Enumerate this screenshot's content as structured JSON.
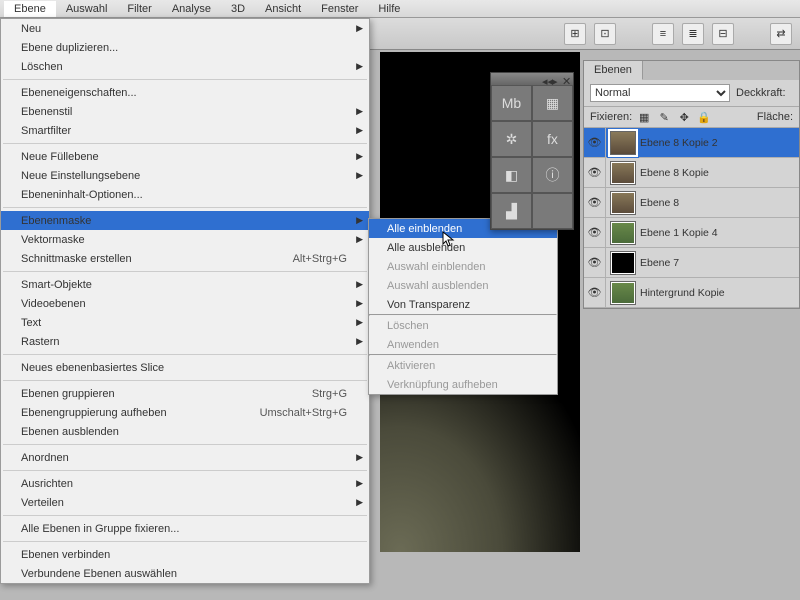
{
  "menubar": [
    "Ebene",
    "Auswahl",
    "Filter",
    "Analyse",
    "3D",
    "Ansicht",
    "Fenster",
    "Hilfe"
  ],
  "menu": {
    "items": [
      {
        "label": "Neu",
        "arrow": true
      },
      {
        "label": "Ebene duplizieren..."
      },
      {
        "label": "Löschen",
        "arrow": true
      },
      {
        "sep": true
      },
      {
        "label": "Ebeneneigenschaften..."
      },
      {
        "label": "Ebenenstil",
        "arrow": true
      },
      {
        "label": "Smartfilter",
        "arrow": true,
        "disabled": true
      },
      {
        "sep": true
      },
      {
        "label": "Neue Füllebene",
        "arrow": true
      },
      {
        "label": "Neue Einstellungsebene",
        "arrow": true
      },
      {
        "label": "Ebeneninhalt-Optionen...",
        "disabled": true
      },
      {
        "sep": true
      },
      {
        "label": "Ebenenmaske",
        "arrow": true,
        "hl": true
      },
      {
        "label": "Vektormaske",
        "arrow": true
      },
      {
        "label": "Schnittmaske erstellen",
        "shortcut": "Alt+Strg+G"
      },
      {
        "sep": true
      },
      {
        "label": "Smart-Objekte",
        "arrow": true
      },
      {
        "label": "Videoebenen",
        "arrow": true
      },
      {
        "label": "Text",
        "arrow": true,
        "disabled": true
      },
      {
        "label": "Rastern",
        "arrow": true,
        "disabled": true
      },
      {
        "sep": true
      },
      {
        "label": "Neues ebenenbasiertes Slice"
      },
      {
        "sep": true
      },
      {
        "label": "Ebenen gruppieren",
        "shortcut": "Strg+G"
      },
      {
        "label": "Ebenengruppierung aufheben",
        "shortcut": "Umschalt+Strg+G",
        "disabled": true
      },
      {
        "label": "Ebenen ausblenden"
      },
      {
        "sep": true
      },
      {
        "label": "Anordnen",
        "arrow": true
      },
      {
        "sep": true
      },
      {
        "label": "Ausrichten",
        "arrow": true,
        "disabled": true
      },
      {
        "label": "Verteilen",
        "arrow": true,
        "disabled": true
      },
      {
        "sep": true
      },
      {
        "label": "Alle Ebenen in Gruppe fixieren...",
        "disabled": true
      },
      {
        "sep": true
      },
      {
        "label": "Ebenen verbinden",
        "disabled": true
      },
      {
        "label": "Verbundene Ebenen auswählen",
        "disabled": true
      }
    ]
  },
  "submenu": {
    "items": [
      {
        "label": "Alle einblenden",
        "hl": true
      },
      {
        "label": "Alle ausblenden"
      },
      {
        "label": "Auswahl einblenden",
        "disabled": true
      },
      {
        "label": "Auswahl ausblenden",
        "disabled": true
      },
      {
        "label": "Von Transparenz"
      },
      {
        "sep": true
      },
      {
        "label": "Löschen",
        "disabled": true
      },
      {
        "label": "Anwenden",
        "disabled": true
      },
      {
        "sep": true
      },
      {
        "label": "Aktivieren",
        "disabled": true
      },
      {
        "label": "Verknüpfung aufheben",
        "disabled": true
      }
    ]
  },
  "layers_panel": {
    "tab": "Ebenen",
    "blend_mode": "Normal",
    "opacity_label": "Deckkraft:",
    "lock_label": "Fixieren:",
    "fill_label": "Fläche:",
    "layers": [
      {
        "name": "Ebene 8 Kopie 2",
        "sel": true,
        "thumb": "meerkat"
      },
      {
        "name": "Ebene 8 Kopie",
        "thumb": "meerkat"
      },
      {
        "name": "Ebene 8",
        "thumb": "meerkat"
      },
      {
        "name": "Ebene 1 Kopie 4",
        "thumb": "bg"
      },
      {
        "name": "Ebene 7",
        "thumb": "black"
      },
      {
        "name": "Hintergrund Kopie",
        "thumb": "bg"
      }
    ]
  },
  "palette_icons": [
    "Mb",
    "▦",
    "✲",
    "fx",
    "◧",
    "ⓘ",
    "▟",
    ""
  ]
}
